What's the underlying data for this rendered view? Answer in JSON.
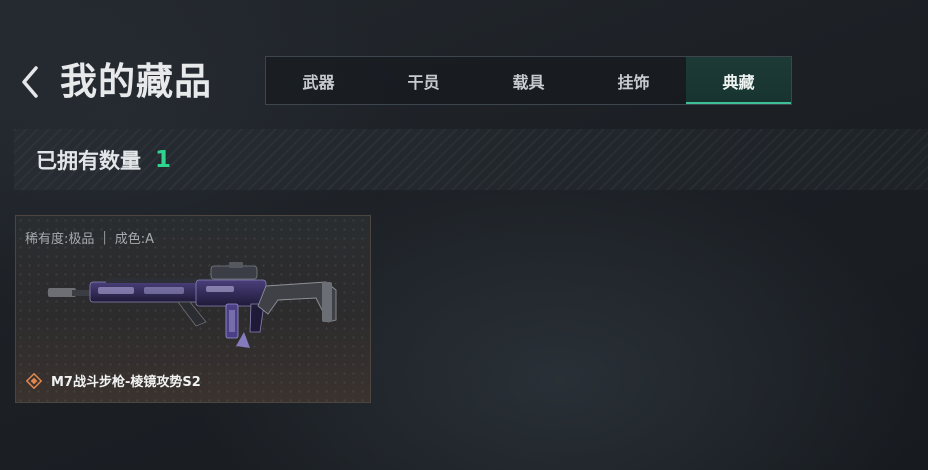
{
  "header": {
    "title": "我的藏品",
    "back_icon": "chevron-left-icon"
  },
  "tabs": [
    {
      "label": "武器",
      "active": false
    },
    {
      "label": "干员",
      "active": false
    },
    {
      "label": "载具",
      "active": false
    },
    {
      "label": "挂饰",
      "active": false
    },
    {
      "label": "典藏",
      "active": true
    }
  ],
  "summary": {
    "owned_label": "已拥有数量",
    "owned_count": "1"
  },
  "items": [
    {
      "rarity": "稀有度:极品",
      "separator": "|",
      "condition": "成色:A",
      "name": "M7战斗步枪-棱镜攻势S2",
      "rarity_icon": "diamond-rarity-icon"
    }
  ],
  "colors": {
    "accent": "#2fd58f",
    "active_tab": "#1d3a36",
    "rarity_orange": "#e0874f"
  }
}
